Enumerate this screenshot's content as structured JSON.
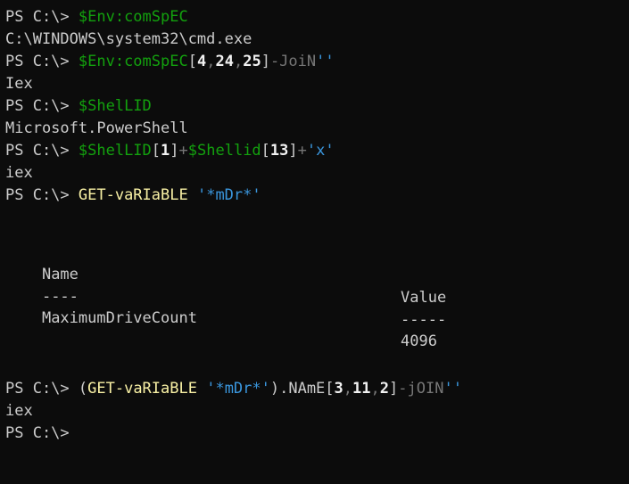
{
  "terminal": {
    "prompt": "PS C:\\> ",
    "lines": [
      {
        "id": "line-1",
        "tokens": [
          {
            "t": "prompt",
            "v": "PS C:\\> "
          },
          {
            "t": "var",
            "v": "$Env:comSpEC"
          }
        ]
      },
      {
        "id": "line-2",
        "tokens": [
          {
            "t": "plain",
            "v": "C:\\WINDOWS\\system32\\cmd.exe"
          }
        ]
      },
      {
        "id": "line-3",
        "tokens": [
          {
            "t": "prompt",
            "v": "PS C:\\> "
          },
          {
            "t": "var",
            "v": "$Env:comSpEC"
          },
          {
            "t": "plain",
            "v": "["
          },
          {
            "t": "num",
            "v": "4"
          },
          {
            "t": "op",
            "v": ","
          },
          {
            "t": "num",
            "v": "24"
          },
          {
            "t": "op",
            "v": ","
          },
          {
            "t": "num",
            "v": "25"
          },
          {
            "t": "plain",
            "v": "]"
          },
          {
            "t": "op",
            "v": "-JoiN"
          },
          {
            "t": "str",
            "v": "''"
          }
        ]
      },
      {
        "id": "line-4",
        "tokens": [
          {
            "t": "plain",
            "v": "Iex"
          }
        ]
      },
      {
        "id": "line-5",
        "tokens": [
          {
            "t": "prompt",
            "v": "PS C:\\> "
          },
          {
            "t": "var",
            "v": "$ShelLID"
          }
        ]
      },
      {
        "id": "line-6",
        "tokens": [
          {
            "t": "plain",
            "v": "Microsoft.PowerShell"
          }
        ]
      },
      {
        "id": "line-7",
        "tokens": [
          {
            "t": "prompt",
            "v": "PS C:\\> "
          },
          {
            "t": "var",
            "v": "$ShelLID"
          },
          {
            "t": "plain",
            "v": "["
          },
          {
            "t": "num",
            "v": "1"
          },
          {
            "t": "plain",
            "v": "]"
          },
          {
            "t": "op",
            "v": "+"
          },
          {
            "t": "var",
            "v": "$Shellid"
          },
          {
            "t": "plain",
            "v": "["
          },
          {
            "t": "num",
            "v": "13"
          },
          {
            "t": "plain",
            "v": "]"
          },
          {
            "t": "op",
            "v": "+"
          },
          {
            "t": "str",
            "v": "'x'"
          }
        ]
      },
      {
        "id": "line-8",
        "tokens": [
          {
            "t": "plain",
            "v": "iex"
          }
        ]
      },
      {
        "id": "line-9",
        "tokens": [
          {
            "t": "prompt",
            "v": "PS C:\\> "
          },
          {
            "t": "cmd",
            "v": "GET-vaRIaBLE"
          },
          {
            "t": "plain",
            "v": " "
          },
          {
            "t": "str",
            "v": "'*mDr*'"
          }
        ]
      },
      {
        "id": "line-12",
        "tokens": [
          {
            "t": "prompt",
            "v": "PS C:\\> "
          },
          {
            "t": "plain",
            "v": "("
          },
          {
            "t": "cmd",
            "v": "GET-vaRIaBLE"
          },
          {
            "t": "plain",
            "v": " "
          },
          {
            "t": "str",
            "v": "'*mDr*'"
          },
          {
            "t": "plain",
            "v": ").NAmE["
          },
          {
            "t": "num",
            "v": "3"
          },
          {
            "t": "op",
            "v": ","
          },
          {
            "t": "num",
            "v": "11"
          },
          {
            "t": "op",
            "v": ","
          },
          {
            "t": "num",
            "v": "2"
          },
          {
            "t": "plain",
            "v": "]"
          },
          {
            "t": "op",
            "v": "-jOIN"
          },
          {
            "t": "str",
            "v": "''"
          }
        ]
      },
      {
        "id": "line-13",
        "tokens": [
          {
            "t": "plain",
            "v": "iex"
          }
        ]
      },
      {
        "id": "line-14",
        "tokens": [
          {
            "t": "prompt",
            "v": "PS C:\\>"
          }
        ]
      }
    ],
    "table": {
      "headers": [
        "Name",
        "Value"
      ],
      "separators": [
        "----",
        "-----"
      ],
      "rows": [
        [
          "MaximumDriveCount",
          "4096"
        ]
      ]
    }
  }
}
